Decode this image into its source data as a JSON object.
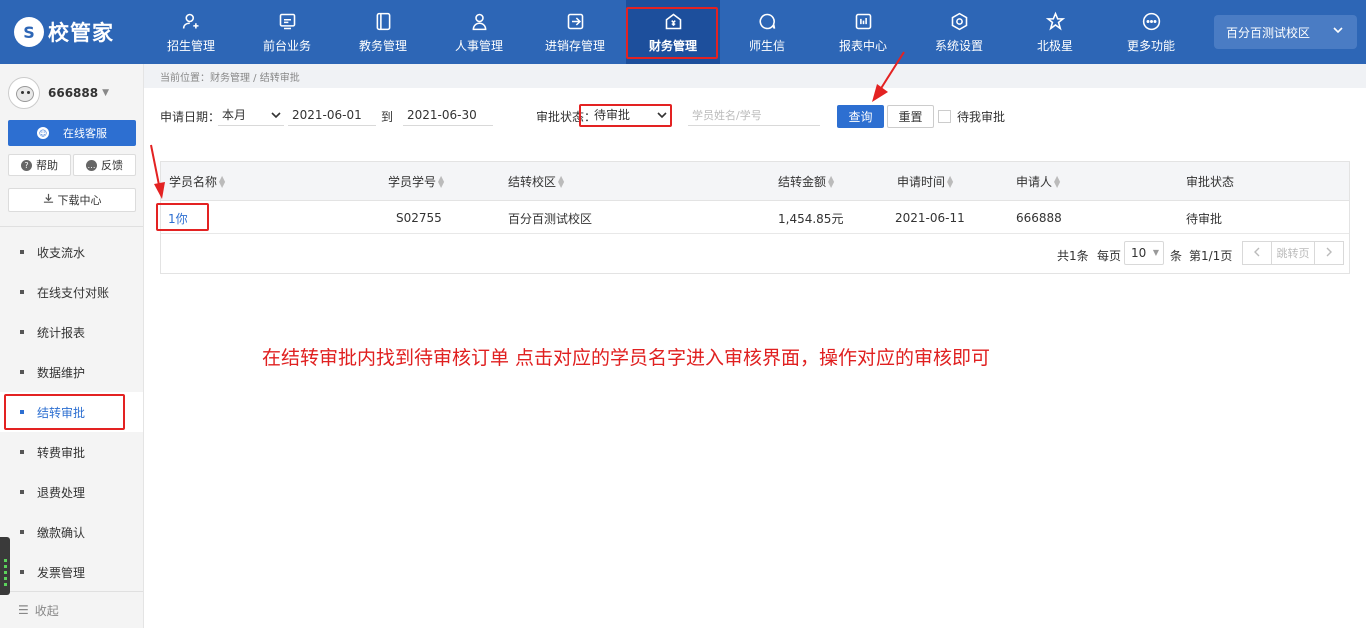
{
  "app": {
    "logo_mark": "S",
    "logo_text": "校管家"
  },
  "nav": [
    {
      "label": "招生管理",
      "icon": "user-add-icon"
    },
    {
      "label": "前台业务",
      "icon": "monitor-icon"
    },
    {
      "label": "教务管理",
      "icon": "book-icon"
    },
    {
      "label": "人事管理",
      "icon": "person-icon"
    },
    {
      "label": "进销存管理",
      "icon": "export-icon"
    },
    {
      "label": "财务管理",
      "icon": "finance-icon",
      "active": true
    },
    {
      "label": "师生信",
      "icon": "chat-icon"
    },
    {
      "label": "报表中心",
      "icon": "report-icon"
    },
    {
      "label": "系统设置",
      "icon": "settings-icon"
    },
    {
      "label": "北极星",
      "icon": "star-icon"
    },
    {
      "label": "更多功能",
      "icon": "more-icon"
    }
  ],
  "campus": {
    "name": "百分百测试校区"
  },
  "sidebar": {
    "username": "666888",
    "service_button": "在线客服",
    "help_button": "帮助",
    "feedback_button": "反馈",
    "download_button": "下载中心",
    "items": [
      {
        "label": "收支流水"
      },
      {
        "label": "在线支付对账"
      },
      {
        "label": "统计报表"
      },
      {
        "label": "数据维护"
      },
      {
        "label": "结转审批",
        "active": true
      },
      {
        "label": "转费审批"
      },
      {
        "label": "退费处理"
      },
      {
        "label": "缴款确认"
      },
      {
        "label": "发票管理"
      }
    ],
    "collapse": "收起"
  },
  "breadcrumb": "当前位置：财务管理 / 结转审批",
  "filters": {
    "apply_date_label": "申请日期：",
    "period_value": "本月",
    "date_from": "2021-06-01",
    "to_label": "到",
    "date_to": "2021-06-30",
    "status_label": "审批状态：",
    "status_value": "待审批",
    "search_placeholder": "学员姓名/学号",
    "query_button": "查询",
    "reset_button": "重置",
    "my_approval_label": "待我审批"
  },
  "table": {
    "columns": [
      "学员名称",
      "学员学号",
      "结转校区",
      "结转金额",
      "申请时间",
      "申请人",
      "审批状态"
    ],
    "rows": [
      {
        "name": "1你",
        "student_no": "S02755",
        "campus": "百分百测试校区",
        "amount": "1,454.85元",
        "time": "2021-06-11",
        "applicant": "666888",
        "status": "待审批"
      }
    ]
  },
  "pager": {
    "total": "共1条",
    "per_page_label": "每页",
    "per_page": "10",
    "unit": "条",
    "page_info": "第1/1页",
    "jump_label": "跳转页"
  },
  "note": "在结转审批内找到待审核订单  点击对应的学员名字进入审核界面，操作对应的审核即可",
  "colors": {
    "topbar": "#2d66b6",
    "accent": "#2d6fd1",
    "annotation": "#e32222"
  }
}
